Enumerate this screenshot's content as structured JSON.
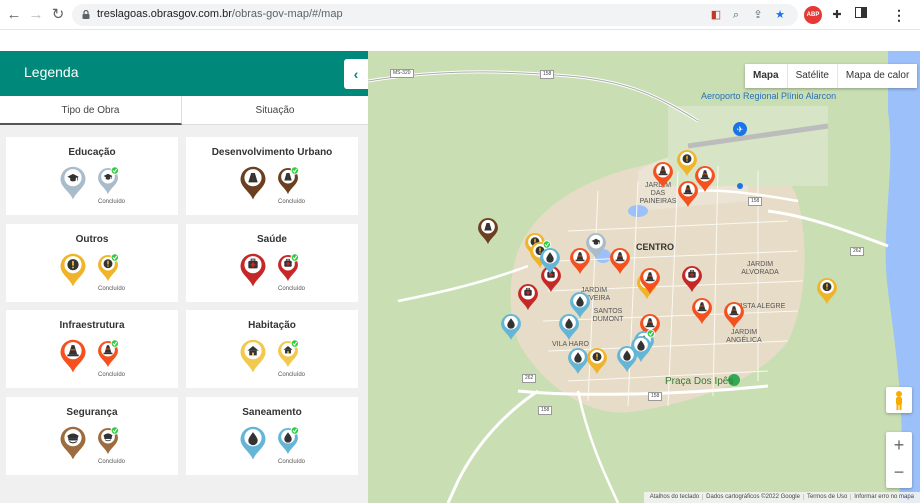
{
  "browser": {
    "url_host": "treslagoas.obrasgov.com.br",
    "url_path": "/obras-gov-map/#/map",
    "abp_label": "ABP"
  },
  "legend": {
    "title": "Legenda",
    "collapse_glyph": "‹",
    "tabs": [
      {
        "label": "Tipo de Obra"
      },
      {
        "label": "Situação"
      }
    ],
    "status_label": "Concluído",
    "categories": [
      {
        "name": "Educação",
        "color": "#a9bccb",
        "icon": "graduation-cap-icon"
      },
      {
        "name": "Desenvolvimento Urbano",
        "color": "#6b3f1f",
        "icon": "road-icon"
      },
      {
        "name": "Outros",
        "color": "#f0b429",
        "icon": "exclamation-icon"
      },
      {
        "name": "Saúde",
        "color": "#c62828",
        "icon": "medical-kit-icon"
      },
      {
        "name": "Infraestrutura",
        "color": "#f4511e",
        "icon": "traffic-cone-icon"
      },
      {
        "name": "Habitação",
        "color": "#f2c94c",
        "icon": "house-icon"
      },
      {
        "name": "Segurança",
        "color": "#9c6b3f",
        "icon": "police-cap-icon"
      },
      {
        "name": "Saneamento",
        "color": "#64b5d6",
        "icon": "water-drop-icon"
      }
    ]
  },
  "map": {
    "type_buttons": [
      {
        "label": "Mapa"
      },
      {
        "label": "Satélite"
      },
      {
        "label": "Mapa de calor"
      }
    ],
    "labels": {
      "airport": "Aeroporto Regional Plínio Alarcon",
      "park": "Praça Dos Ipês",
      "centro": "CENTRO",
      "jardim_alvorada": "JARDIM ALVORADA",
      "vista_alegre": "VISTA ALEGRE",
      "jardim_angelica": "JARDIM ANGÉLICA",
      "jardim_paineiras": "JARDIM DAS PAINEIRAS",
      "santos_dumont": "SANTOS DUMONT",
      "jardim_oliveira": "JARDIM OLIVEIRA",
      "vila_haro": "VILA HARO",
      "route_158": "158",
      "route_262": "262",
      "route_ms320": "MS-320"
    },
    "zoom_in": "+",
    "zoom_out": "−",
    "attribution": [
      "Atalhos do teclado",
      "Dados cartográficos ©2022 Google",
      "Termos de Uso",
      "Informar erro no mapa"
    ]
  }
}
